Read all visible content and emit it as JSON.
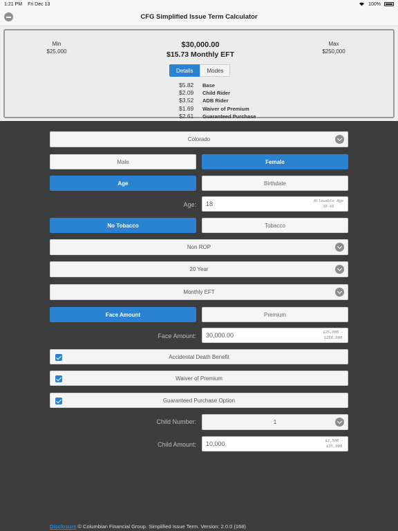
{
  "status_bar": {
    "time": "1:21 PM",
    "date": "Fri Dec 13",
    "battery": "100%"
  },
  "nav": {
    "title": "CFG Simplified Issue Term Calculator"
  },
  "summary": {
    "min_label": "Min",
    "min_value": "$25,000",
    "max_label": "Max",
    "max_value": "$250,000",
    "face": "$30,000.00",
    "premium": "$15.73  Monthly EFT",
    "tabs": [
      "Details",
      "Modes"
    ],
    "breakdown": [
      {
        "amount": "$5.82",
        "label": "Base"
      },
      {
        "amount": "$2.09",
        "label": "Child Rider"
      },
      {
        "amount": "$3.52",
        "label": "ADB Rider"
      },
      {
        "amount": "$1.69",
        "label": "Waiver of Premium"
      },
      {
        "amount": "$2.61",
        "label": "Guaranteed Purchase"
      }
    ]
  },
  "form": {
    "state": "Colorado",
    "gender": {
      "left": "Male",
      "right": "Female",
      "selected": "right"
    },
    "age_mode": {
      "left": "Age",
      "right": "Birthdate",
      "selected": "left"
    },
    "age": {
      "label": "Age:",
      "value": "18",
      "hint_line1": "Allowable Age",
      "hint_line2": "18-65"
    },
    "tobacco": {
      "left": "No Tobacco",
      "right": "Tobacco",
      "selected": "left"
    },
    "rop": "Non ROP",
    "term": "20 Year",
    "mode": "Monthly EFT",
    "calc_by": {
      "left": "Face Amount",
      "right": "Premium",
      "selected": "left"
    },
    "face_amount": {
      "label": "Face Amount:",
      "value": "30,000.00",
      "hint_line1": "$25,000 -",
      "hint_line2": "$250,000"
    },
    "riders": [
      "Accidental Death Benefit",
      "Waiver of Premium",
      "Guaranteed Purchase Option"
    ],
    "child_number": {
      "label": "Child Number:",
      "value": "1"
    },
    "child_amount": {
      "label": "Child Amount:",
      "value": "10,000",
      "hint_line1": "$2,500 -",
      "hint_line2": "$15,000"
    }
  },
  "footer": {
    "link": "Disclosure",
    "text": " © Columbian Financial Group. Simplified Issue Term.    Version: 2.0.0 (168)"
  },
  "colors": {
    "accent": "#2b82d0",
    "background": "#3d3d3d"
  }
}
